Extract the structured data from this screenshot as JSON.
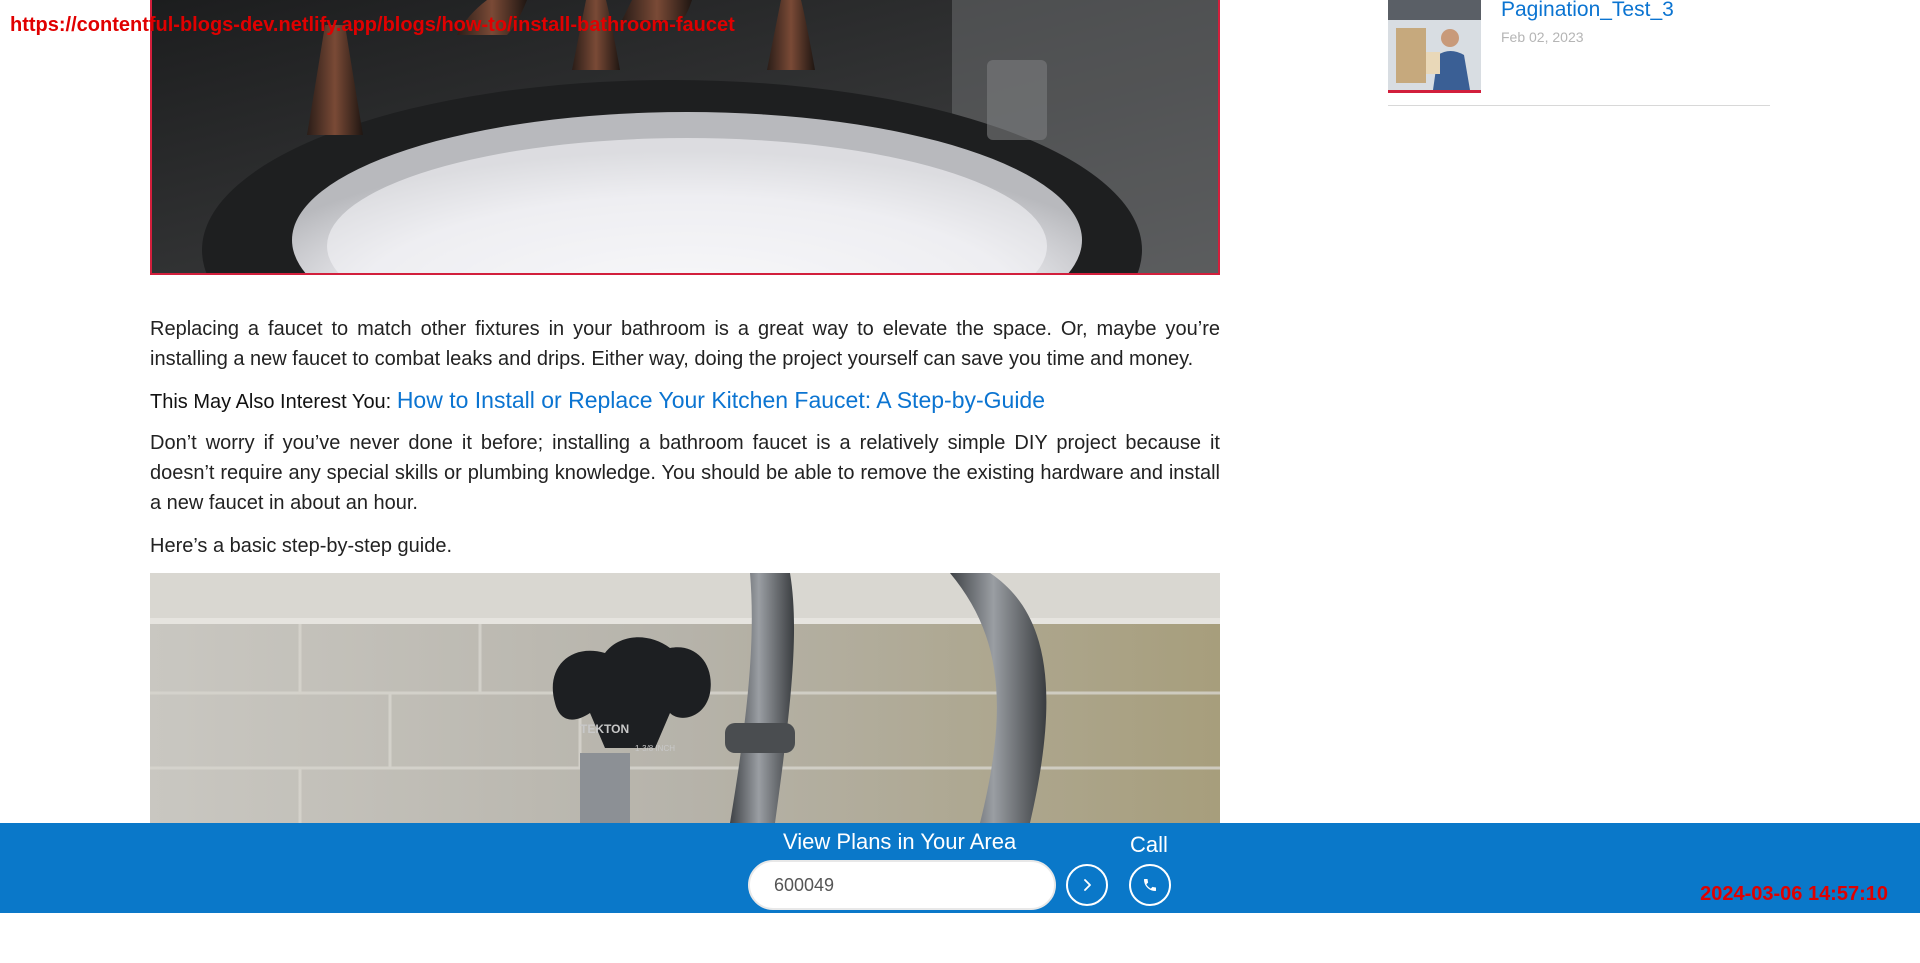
{
  "browser": {
    "url": "https://contentful-blogs-dev.netlify.app/blogs/how-to/install-bathroom-faucet",
    "timestamp": "2024-03-06 14:57:10"
  },
  "article": {
    "paragraph_1": "Replacing a faucet to match other fixtures in your bathroom is a great way to elevate the space. Or, maybe you’re installing a new faucet to combat leaks and drips. Either way, doing the project yourself can save you time and money.",
    "interest_label": "This May Also Interest You:",
    "interest_link": "How to Install or Replace Your Kitchen Faucet: A Step-by-Guide",
    "paragraph_2": "Don’t worry if you’ve never done it before; installing a bathroom faucet is a relatively simple DIY project because it doesn’t require any special skills or plumbing knowledge. You should be able to remove the existing hardware and install a new faucet in about an hour.",
    "paragraph_3": "Here’s a basic step-by-step guide.",
    "tool_brand": "TEKTON",
    "tool_size": "1-3/8 INCH"
  },
  "sidebar": {
    "post_title": "Pagination_Test_3",
    "post_date": "Feb 02, 2023"
  },
  "bottom_bar": {
    "title": "View Plans in Your Area",
    "zip_value": "600049",
    "call_label": "Call"
  },
  "colors": {
    "bar_blue": "#0a78c9",
    "link_blue": "#0b74d1",
    "accent_red": "#d21f3c"
  }
}
